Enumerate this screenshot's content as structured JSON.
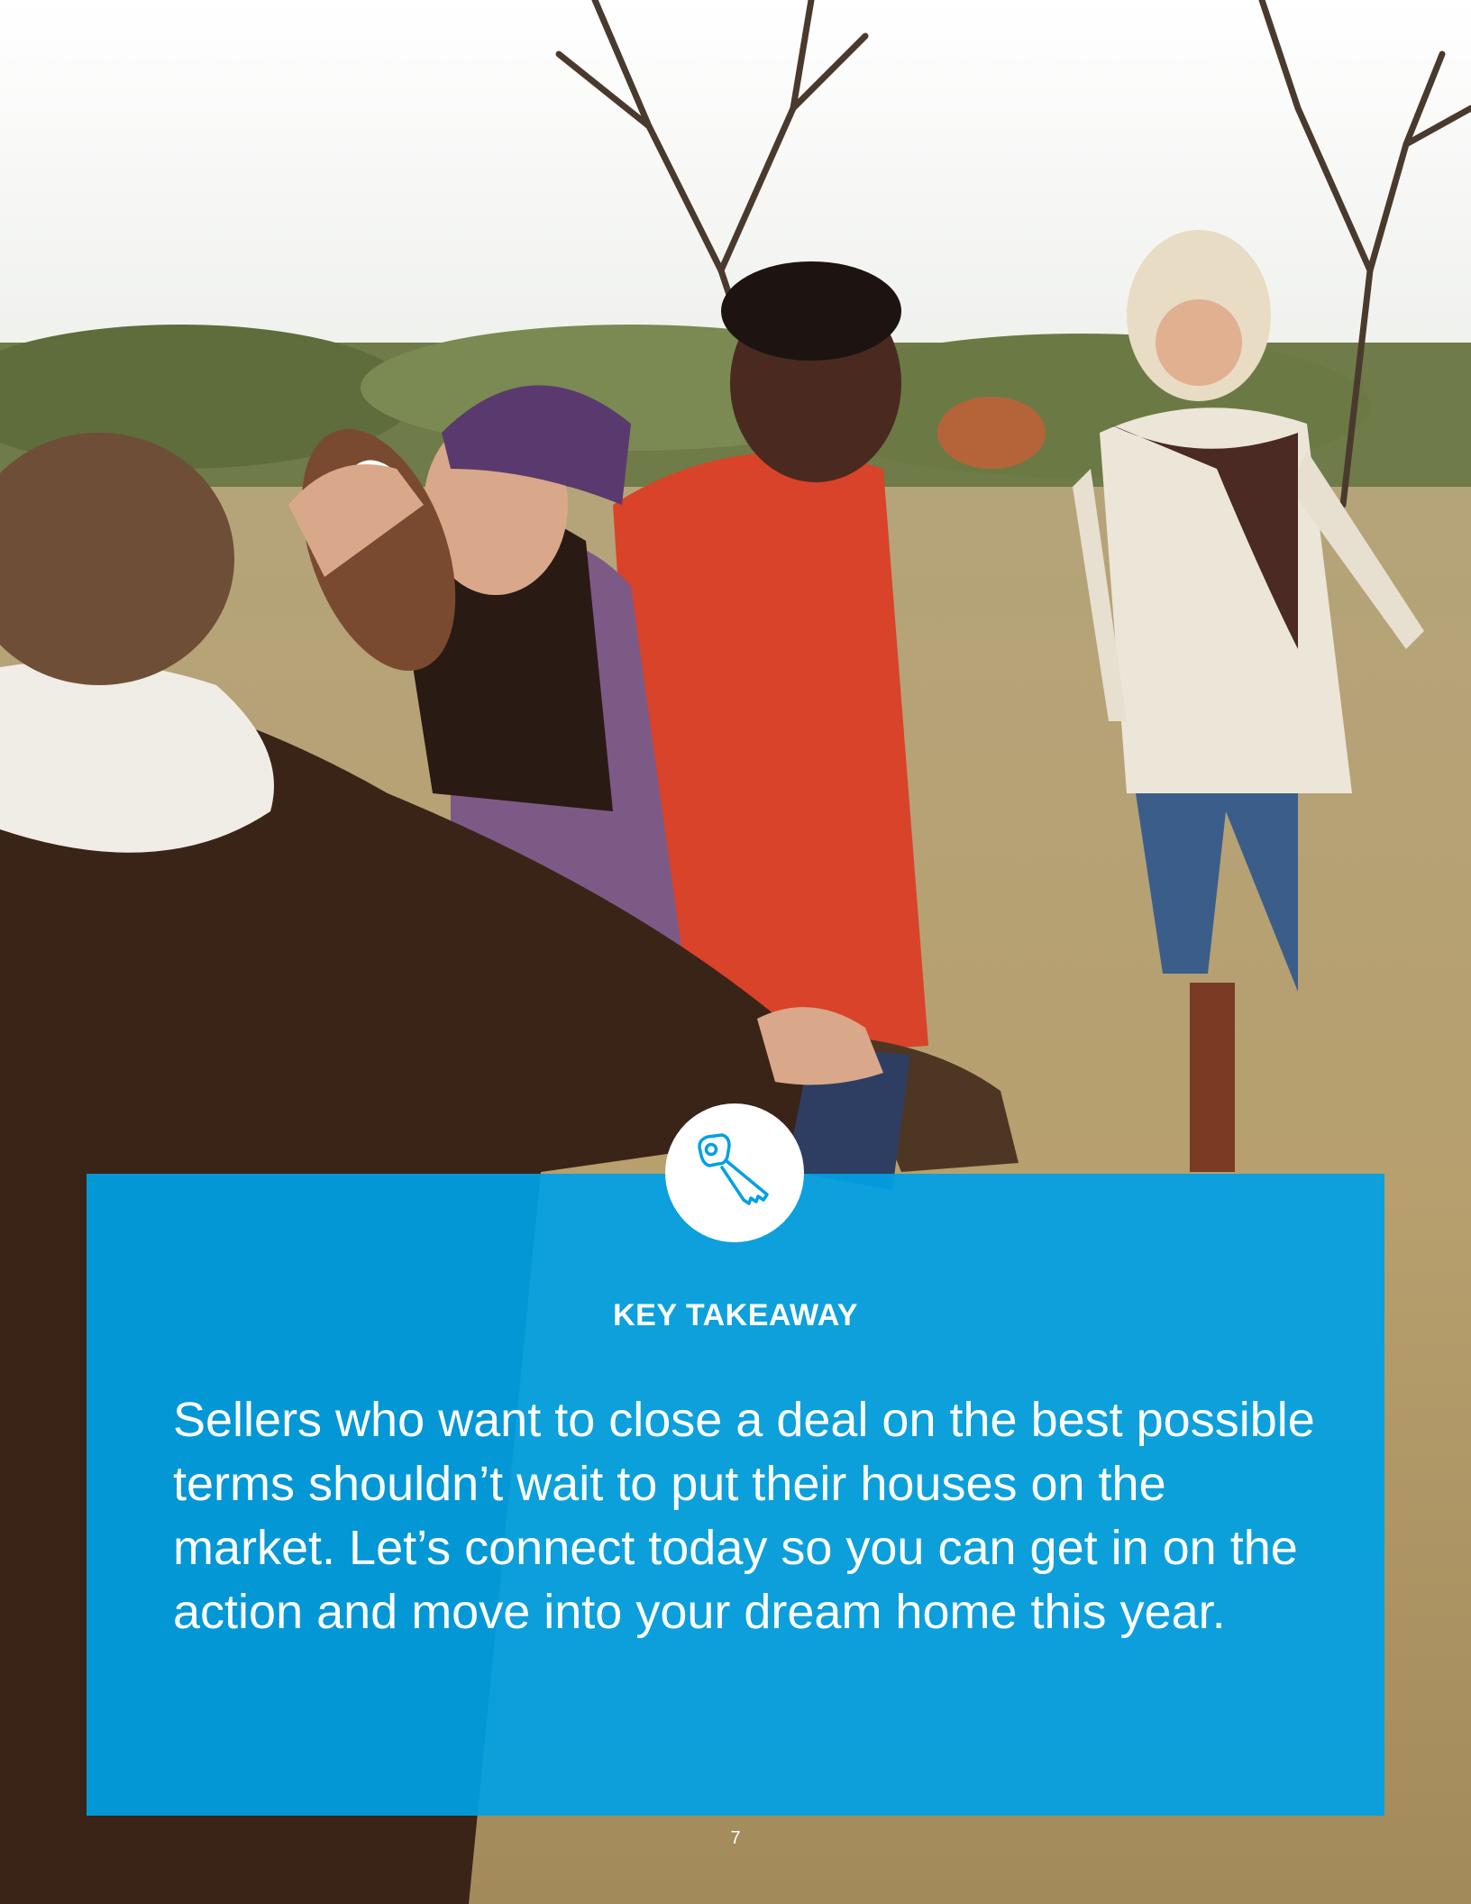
{
  "takeaway": {
    "heading": "KEY TAKEAWAY",
    "body": "Sellers who want to close a deal on the best possible terms shouldn’t wait to put their houses on the market. Let’s connect today so you can get in on the action and move into your dream home this year.",
    "icon": "key-icon"
  },
  "footer": {
    "page_number": "7"
  },
  "colors": {
    "box": "#00A0E4",
    "text": "#FFFFFF"
  }
}
